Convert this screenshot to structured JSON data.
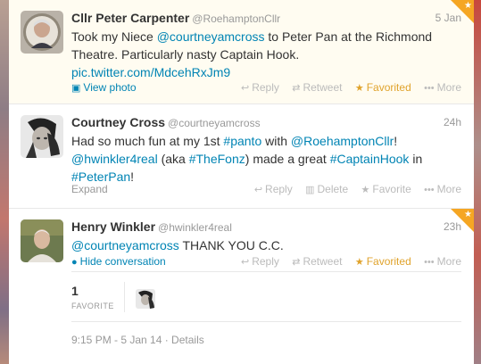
{
  "colors": {
    "link": "#0084b4",
    "favorited": "#e0a32c",
    "muted": "#999999"
  },
  "tweets": [
    {
      "fullname": "Cllr Peter Carpenter",
      "username": "@RoehamptonCllr",
      "time": "5 Jan",
      "text": {
        "p1": "Took my Niece ",
        "mention": "@courtneyamcross",
        "p2": " to Peter Pan at the Richmond Theatre. Particularly nasty Captain Hook.",
        "link": "pic.twitter.com/MdcehRxJm9"
      },
      "left_action": "View photo",
      "actions": {
        "reply": "Reply",
        "retweet": "Retweet",
        "favorite": "Favorited",
        "more": "More"
      }
    },
    {
      "fullname": "Courtney Cross",
      "username": "@courtneyamcross",
      "time": "24h",
      "text": {
        "p1": "Had so much fun at my 1st ",
        "tag1": "#panto",
        "p2": " with ",
        "mention1": "@RoehamptonCllr",
        "p3": "! ",
        "mention2": "@hwinkler4real",
        "p4": " (aka ",
        "tag2": "#TheFonz",
        "p5": ") made a great ",
        "tag3": "#CaptainHook",
        "p6": " in ",
        "tag4": "#PeterPan",
        "p7": "!"
      },
      "left_action": "Expand",
      "actions": {
        "reply": "Reply",
        "delete": "Delete",
        "favorite": "Favorite",
        "more": "More"
      }
    },
    {
      "fullname": "Henry Winkler",
      "username": "@hwinkler4real",
      "time": "23h",
      "text": {
        "mention": "@courtneyamcross",
        "p1": " THANK YOU C.C."
      },
      "left_action": "Hide conversation",
      "actions": {
        "reply": "Reply",
        "retweet": "Retweet",
        "favorite": "Favorited",
        "more": "More"
      },
      "stats": {
        "count": "1",
        "label": "FAVORITE"
      },
      "details": "9:15 PM - 5 Jan 14 · Details"
    }
  ]
}
